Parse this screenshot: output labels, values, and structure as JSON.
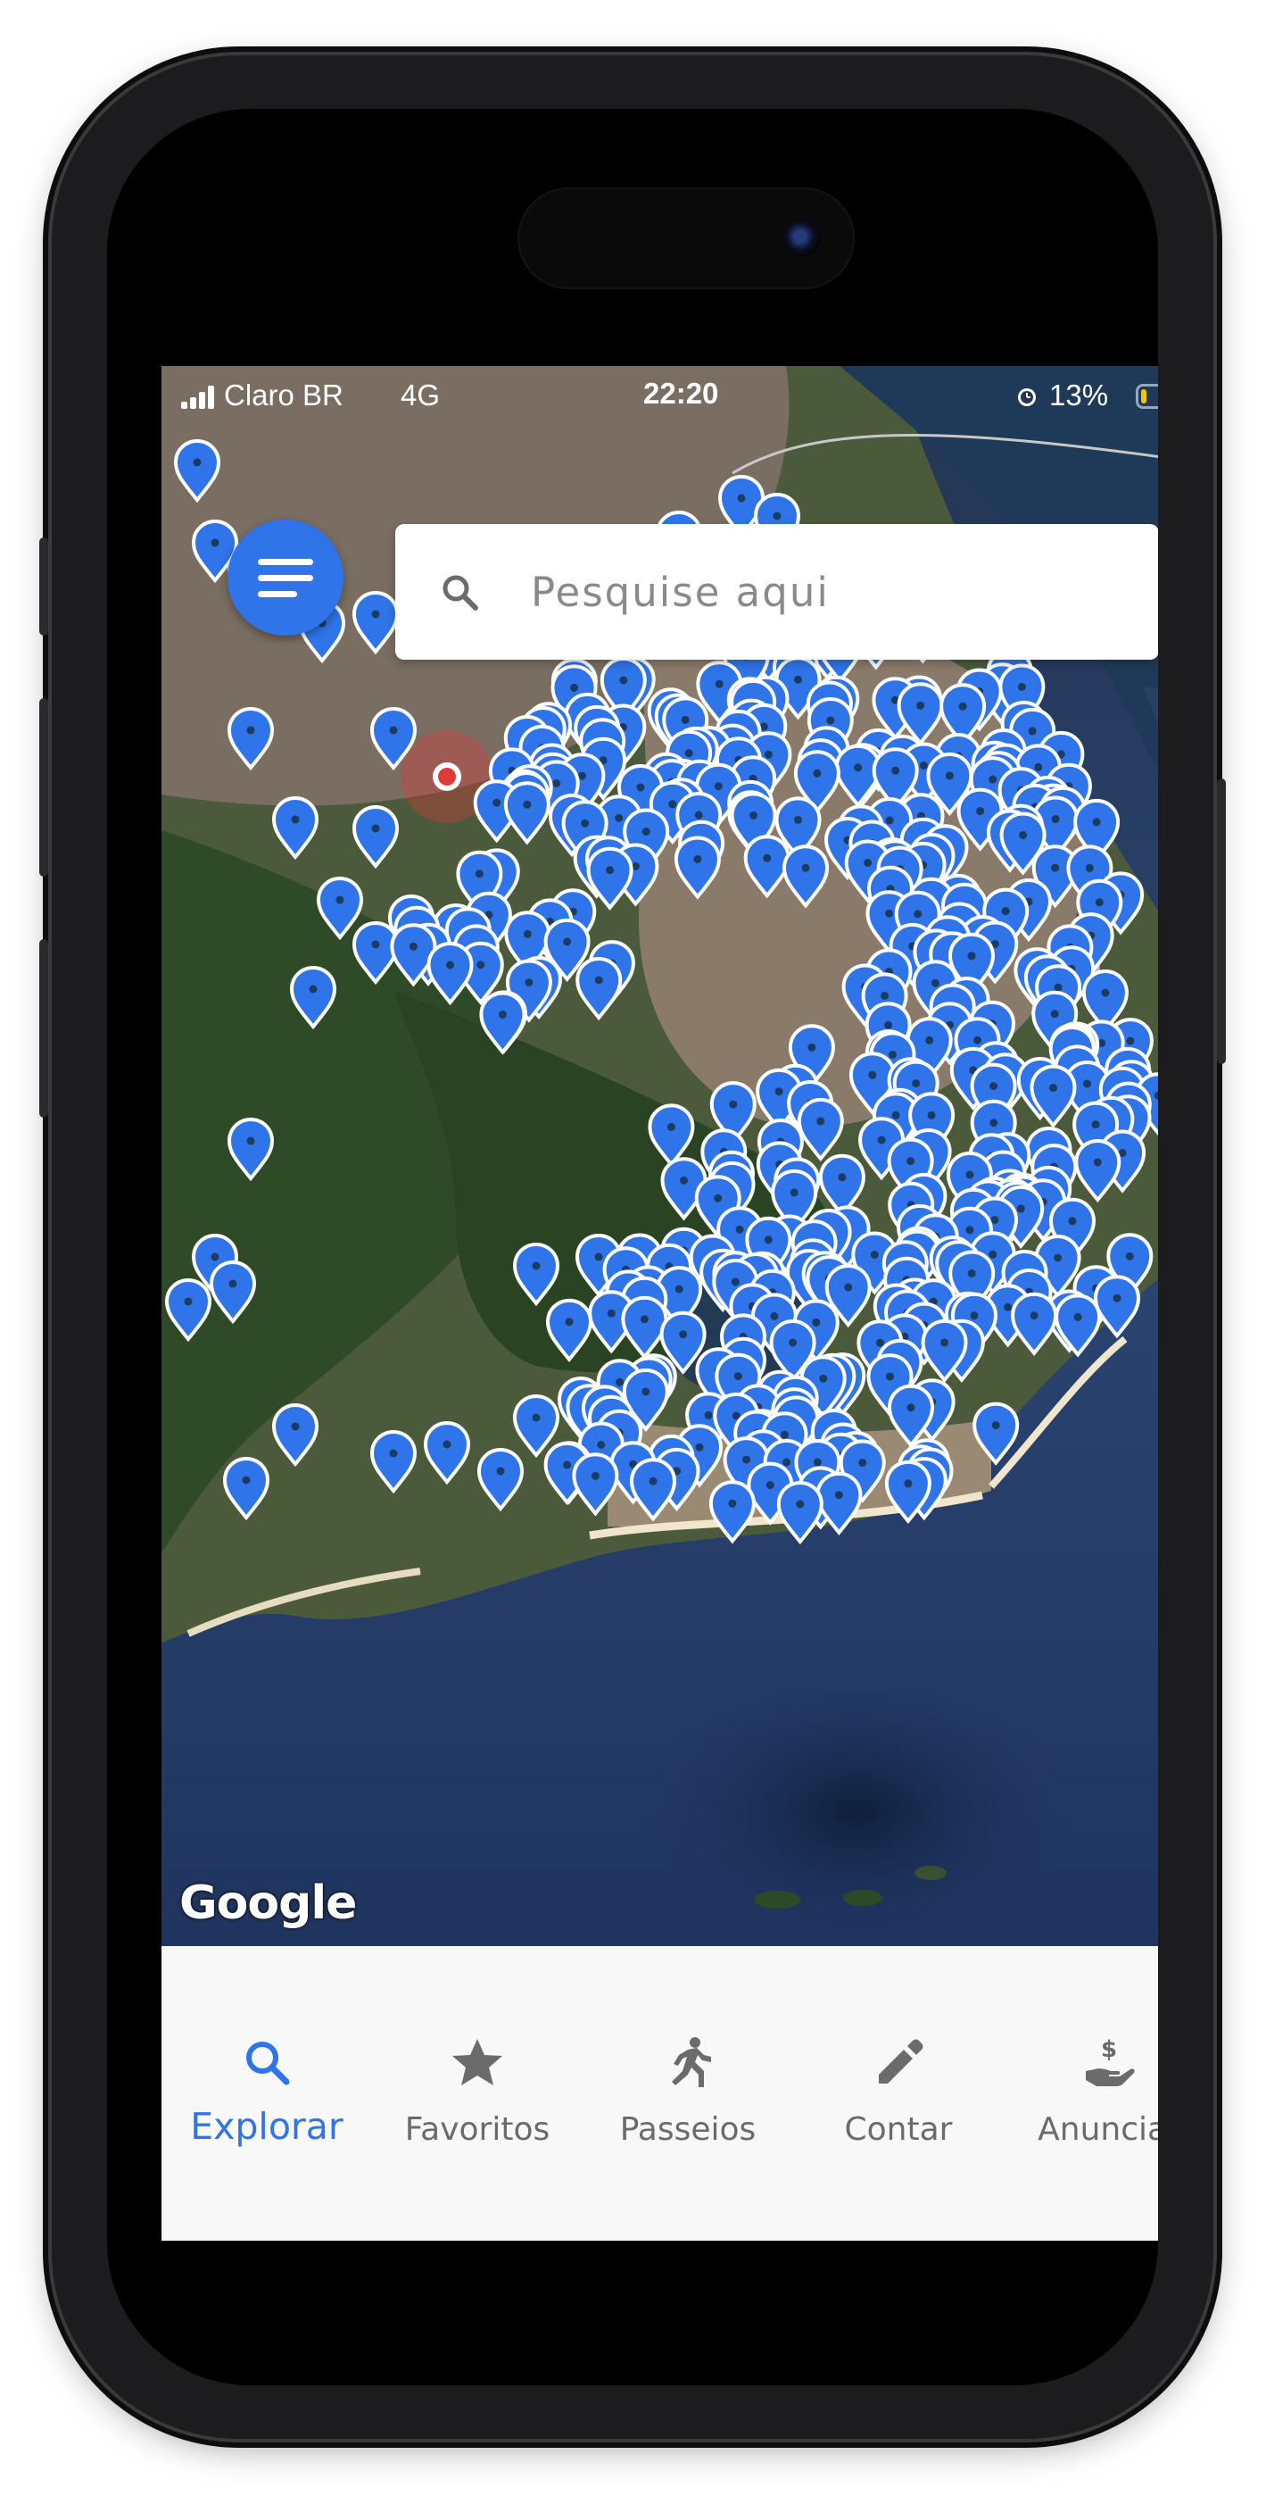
{
  "status_bar": {
    "carrier": "Claro BR",
    "network": "4G",
    "time": "22:20",
    "battery_percent": "13%",
    "battery_level": 0.13,
    "icons": [
      "signal-icon",
      "alarm-icon",
      "battery-icon"
    ]
  },
  "map": {
    "menu_icon": "hamburger-menu-icon",
    "search": {
      "placeholder": "Pesquise aqui",
      "icon": "search-icon"
    },
    "attribution": "Google",
    "marker_color": "#2f74e8",
    "current_location_color": "#e03a3a"
  },
  "bottom_nav": {
    "active_color": "#2f74e8",
    "items": [
      {
        "label": "Explorar",
        "icon": "search-icon",
        "active": true
      },
      {
        "label": "Favoritos",
        "icon": "star-icon",
        "active": false
      },
      {
        "label": "Passeios",
        "icon": "running-person-icon",
        "active": false
      },
      {
        "label": "Contar",
        "icon": "pencil-icon",
        "active": false
      },
      {
        "label": "Anunciar",
        "icon": "hand-coin-icon",
        "active": false
      }
    ]
  }
}
